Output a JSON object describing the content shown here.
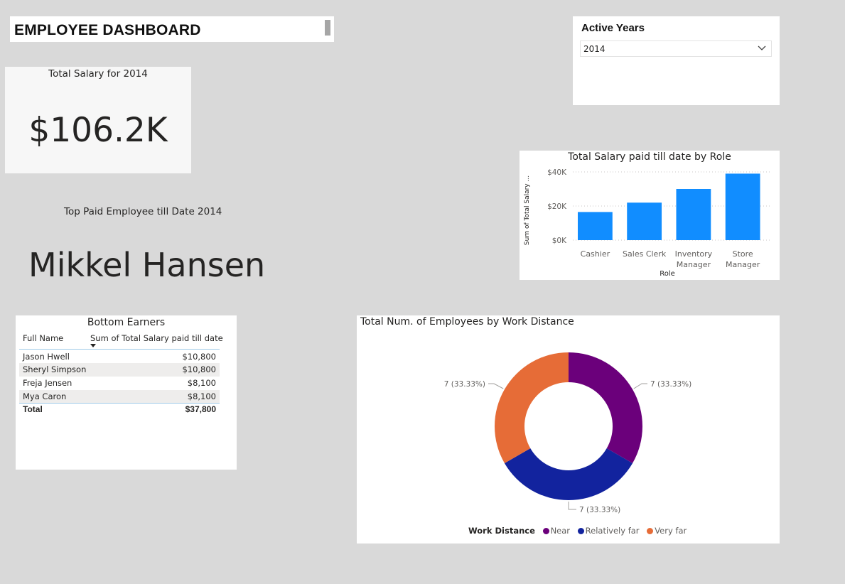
{
  "dashboard": {
    "title": "EMPLOYEE DASHBOARD"
  },
  "slicer": {
    "label": "Active Years",
    "selected": "2014"
  },
  "kpi": {
    "caption": "Total Salary for 2014",
    "value": "$106.2K"
  },
  "top_paid": {
    "caption": "Top Paid Employee till Date 2014",
    "name": "Mikkel Hansen"
  },
  "bottom_earners": {
    "title": "Bottom Earners",
    "columns": [
      "Full Name",
      "Sum of Total Salary paid till date"
    ],
    "rows": [
      {
        "name": "Jason Hwell",
        "value": "$10,800"
      },
      {
        "name": "Sheryl Simpson",
        "value": "$10,800"
      },
      {
        "name": "Freja Jensen",
        "value": "$8,100"
      },
      {
        "name": "Mya Caron",
        "value": "$8,100"
      }
    ],
    "total_label": "Total",
    "total_value": "$37,800"
  },
  "chart_data": [
    {
      "type": "bar",
      "title": "Total Salary paid till date by Role",
      "xlabel": "Role",
      "ylabel": "Sum of Total Salary ...",
      "categories": [
        "Cashier",
        "Sales Clerk",
        "Inventory Manager",
        "Store Manager"
      ],
      "category_lines": [
        [
          "Cashier"
        ],
        [
          "Sales Clerk"
        ],
        [
          "Inventory",
          "Manager"
        ],
        [
          "Store",
          "Manager"
        ]
      ],
      "values": [
        16500,
        22000,
        30000,
        39000
      ],
      "yticks": [
        "$0K",
        "$20K",
        "$40K"
      ],
      "ytick_values": [
        0,
        20000,
        40000
      ],
      "ylim": [
        0,
        40000
      ],
      "grid": true,
      "color": "#118dff"
    },
    {
      "type": "pie",
      "title": "Total Num. of Employees by Work Distance",
      "legend_title": "Work Distance",
      "legend_position": "bottom",
      "slices": [
        {
          "label": "Near",
          "value": 7,
          "display": "7 (33.33%)",
          "color": "#6b007b"
        },
        {
          "label": "Relatively far",
          "value": 7,
          "display": "7 (33.33%)",
          "color": "#12239e"
        },
        {
          "label": "Very far",
          "value": 7,
          "display": "7 (33.33%)",
          "color": "#e66c37"
        }
      ]
    }
  ]
}
